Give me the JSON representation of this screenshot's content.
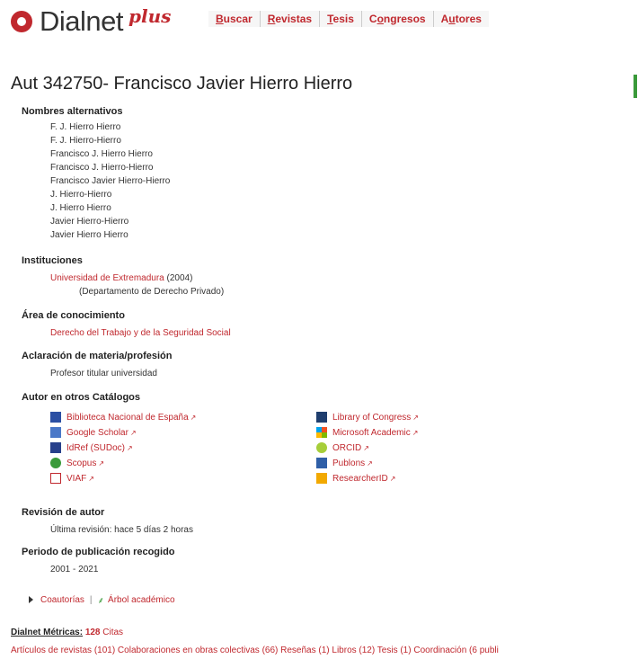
{
  "header": {
    "brand": "Dialnet",
    "brand_plus": "plus",
    "nav": [
      {
        "pre": "",
        "u": "B",
        "post": "uscar"
      },
      {
        "pre": "",
        "u": "R",
        "post": "evistas"
      },
      {
        "pre": "",
        "u": "T",
        "post": "esis"
      },
      {
        "pre": "C",
        "u": "o",
        "post": "ngresos"
      },
      {
        "pre": "A",
        "u": "u",
        "post": "tores"
      }
    ]
  },
  "author": {
    "title": "Aut 342750- Francisco Javier Hierro Hierro",
    "alt_names_heading": "Nombres alternativos",
    "alt_names": [
      "F. J. Hierro Hierro",
      "F. J. Hierro-Hierro",
      "Francisco J. Hierro Hierro",
      "Francisco J. Hierro-Hierro",
      "Francisco Javier Hierro-Hierro",
      "J. Hierro-Hierro",
      "J. Hierro Hierro",
      "Javier Hierro-Hierro",
      "Javier Hierro Hierro"
    ],
    "institutions_heading": "Instituciones",
    "institution_name": "Universidad de Extremadura",
    "institution_year": " (2004)",
    "institution_dept": "(Departamento de Derecho Privado)",
    "area_heading": "Área de conocimiento",
    "area_value": "Derecho del Trabajo y de la Seguridad Social",
    "profession_heading": "Aclaración de materia/profesión",
    "profession_value": "Profesor titular universidad",
    "catalogs_heading": "Autor en otros Catálogos",
    "catalogs_left": [
      {
        "label": "Biblioteca Nacional de España",
        "icon": "bne-icon",
        "color": "#2b4fa3"
      },
      {
        "label": "Google Scholar",
        "icon": "google-scholar-icon",
        "color": "#4a78c8"
      },
      {
        "label": "IdRef (SUDoc)",
        "icon": "idref-icon",
        "color": "#27408b"
      },
      {
        "label": "Scopus",
        "icon": "scopus-icon",
        "color": "#3a9a3a"
      },
      {
        "label": "VIAF",
        "icon": "viaf-icon",
        "color": "#c0282e"
      }
    ],
    "catalogs_right": [
      {
        "label": "Library of Congress",
        "icon": "loc-icon",
        "color": "#1f3e6e"
      },
      {
        "label": "Microsoft Academic",
        "icon": "microsoft-icon",
        "color": "#e8542f"
      },
      {
        "label": "ORCID",
        "icon": "orcid-icon",
        "color": "#a6ce39"
      },
      {
        "label": "Publons",
        "icon": "publons-icon",
        "color": "#2f5fa7"
      },
      {
        "label": "ResearcherID",
        "icon": "researcherid-icon",
        "color": "#f2a900"
      }
    ],
    "revision_heading": "Revisión de autor",
    "revision_value": "Última revisión: hace 5 días 2 horas",
    "period_heading": "Periodo de publicación recogido",
    "period_value": "2001 - 2021",
    "coauthors_label": "Coautorías",
    "separator": "|",
    "tree_label": "Árbol académico",
    "metrics_label": "Dialnet Métricas:",
    "metrics_count": "128",
    "metrics_unit": " Citas",
    "bottom_links": "Artículos de revistas (101) Colaboraciones en obras colectivas (66) Reseñas (1) Libros (12) Tesis (1) Coordinación (6 publi"
  },
  "colors": {
    "accent": "#c0282e",
    "green": "#3a9a3a"
  }
}
